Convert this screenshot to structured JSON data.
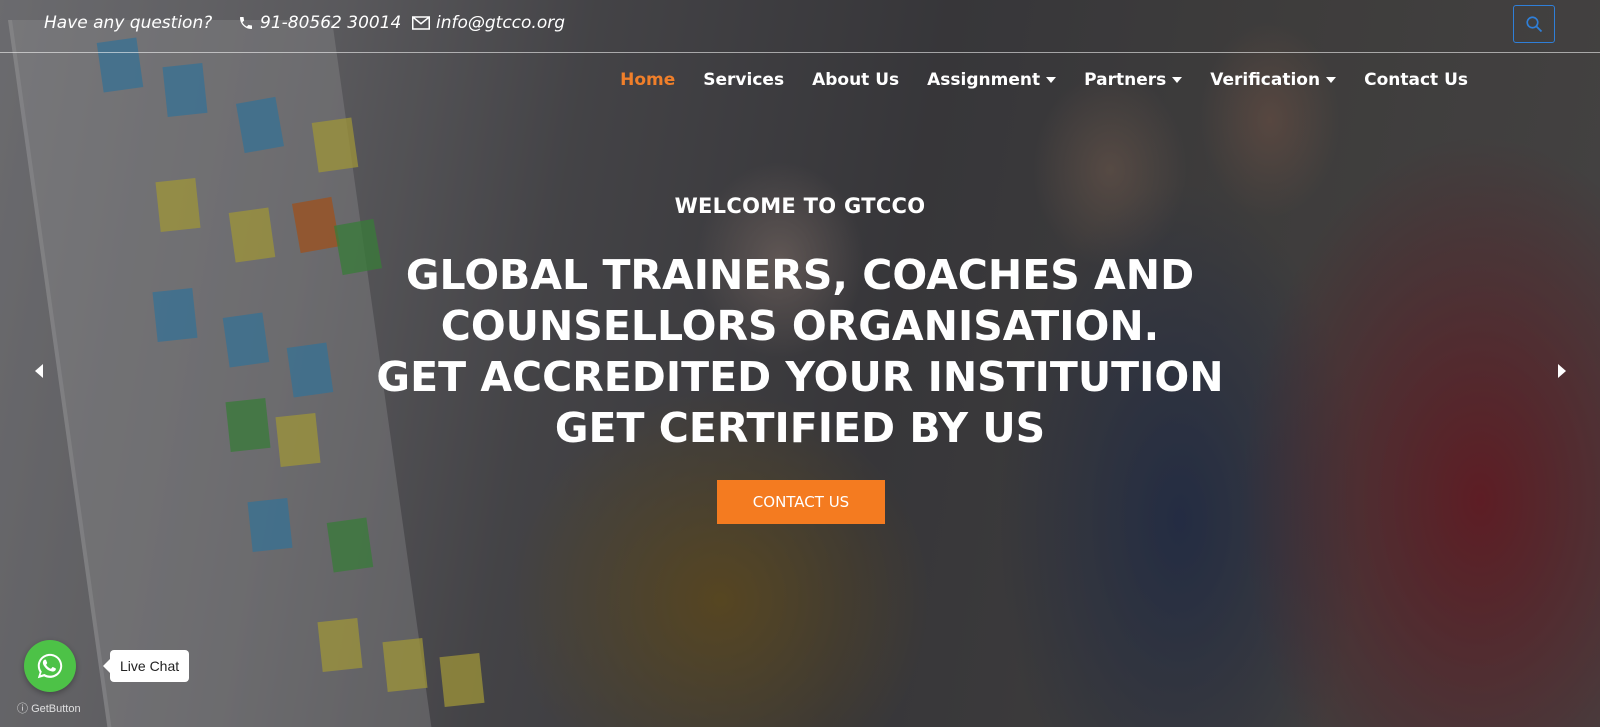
{
  "topbar": {
    "question": "Have any question?",
    "phone": "91-80562 30014",
    "email": "info@gtcco.org"
  },
  "nav": {
    "items": [
      {
        "label": "Home",
        "active": true
      },
      {
        "label": "Services"
      },
      {
        "label": "About Us"
      },
      {
        "label": "Assignment",
        "dropdown": true
      },
      {
        "label": "Partners",
        "dropdown": true
      },
      {
        "label": "Verification",
        "dropdown": true
      },
      {
        "label": "Contact Us"
      }
    ]
  },
  "hero": {
    "welcome": "WELCOME TO GTCCO",
    "lines": [
      "GLOBAL TRAINERS, COACHES AND",
      "COUNSELLORS ORGANISATION.",
      "GET ACCREDITED YOUR INSTITUTION",
      "GET CERTIFIED BY US"
    ],
    "cta": "CONTACT US"
  },
  "widget": {
    "live_chat": "Live Chat",
    "brand": "GetButton"
  },
  "colors": {
    "accent": "#f47b20",
    "active_nav": "#f07f2a",
    "whatsapp": "#4dc247",
    "search_border": "#2f7fd8"
  }
}
